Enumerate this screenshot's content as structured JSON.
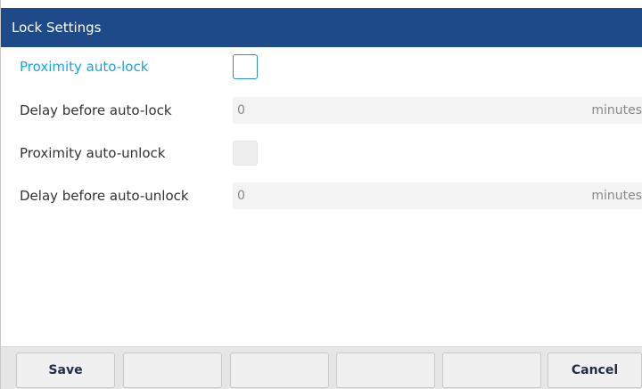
{
  "header": {
    "title": "Lock Settings"
  },
  "settings": {
    "proximity_auto_lock": {
      "label": "Proximity auto-lock",
      "checked": false
    },
    "delay_auto_lock": {
      "label": "Delay before auto-lock",
      "value": "0",
      "unit": "minutes"
    },
    "proximity_auto_unlock": {
      "label": "Proximity auto-unlock",
      "checked": false,
      "disabled": true
    },
    "delay_auto_unlock": {
      "label": "Delay before auto-unlock",
      "value": "0",
      "unit": "minutes"
    }
  },
  "softkeys": {
    "save": "Save",
    "key2": "",
    "key3": "",
    "key4": "",
    "key5": "",
    "cancel": "Cancel"
  },
  "colors": {
    "title_bar": "#1f4a8a",
    "active_label": "#1aa3e0",
    "focus_border": "#2a8bd8"
  }
}
